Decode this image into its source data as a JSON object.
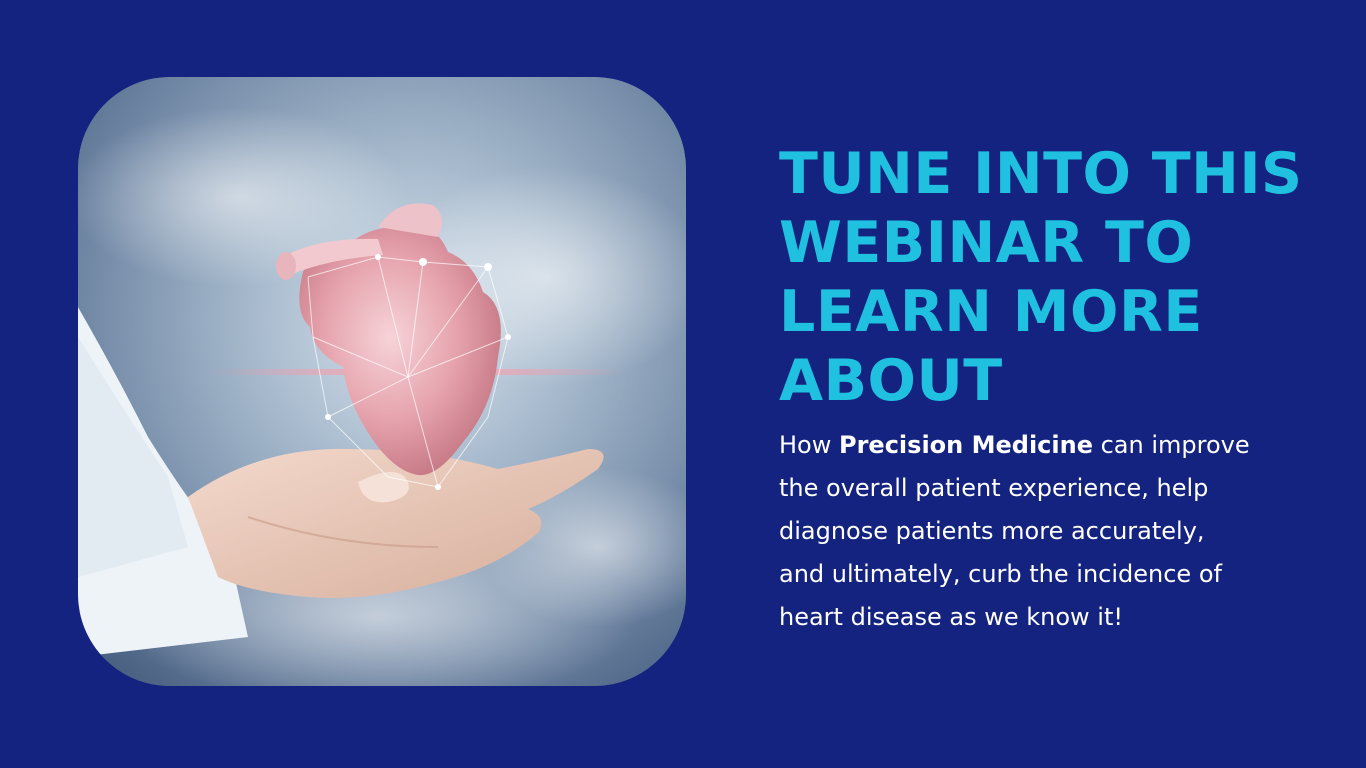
{
  "image": {
    "subject": "hand-holding-heart-photo",
    "colors": {
      "background": "#13237f",
      "headline": "#1fc0e0",
      "body": "#ffffff"
    }
  },
  "headline": {
    "lines": [
      "TUNE INTO THIS",
      "WEBINAR TO",
      "LEARN MORE",
      "ABOUT"
    ]
  },
  "body": {
    "line1_prefix": "How ",
    "line1_bold": "Precision Medicine",
    "line1_suffix": " can improve",
    "line2": "the overall patient experience, help",
    "line3": "diagnose patients more accurately,",
    "line4": "and ultimately, curb the incidence of",
    "line5": "heart disease as we know it!"
  }
}
